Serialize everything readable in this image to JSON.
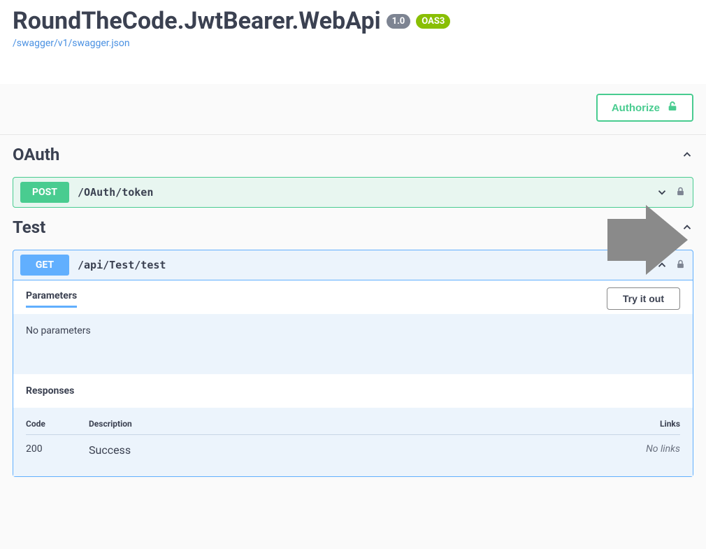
{
  "header": {
    "title": "RoundTheCode.JwtBearer.WebApi",
    "version_badge": "1.0",
    "oas_badge": "OAS3",
    "spec_link": "/swagger/v1/swagger.json"
  },
  "toolbar": {
    "authorize_label": "Authorize"
  },
  "tags": {
    "oauth": {
      "name": "OAuth"
    },
    "test": {
      "name": "Test"
    }
  },
  "ops": {
    "oauth_token": {
      "method": "POST",
      "path": "/OAuth/token"
    },
    "test_get": {
      "method": "GET",
      "path": "/api/Test/test",
      "parameters_label": "Parameters",
      "try_label": "Try it out",
      "no_params": "No parameters",
      "responses_label": "Responses",
      "col_code": "Code",
      "col_desc": "Description",
      "col_links": "Links",
      "rows": [
        {
          "code": "200",
          "desc": "Success",
          "links": "No links"
        }
      ]
    }
  }
}
